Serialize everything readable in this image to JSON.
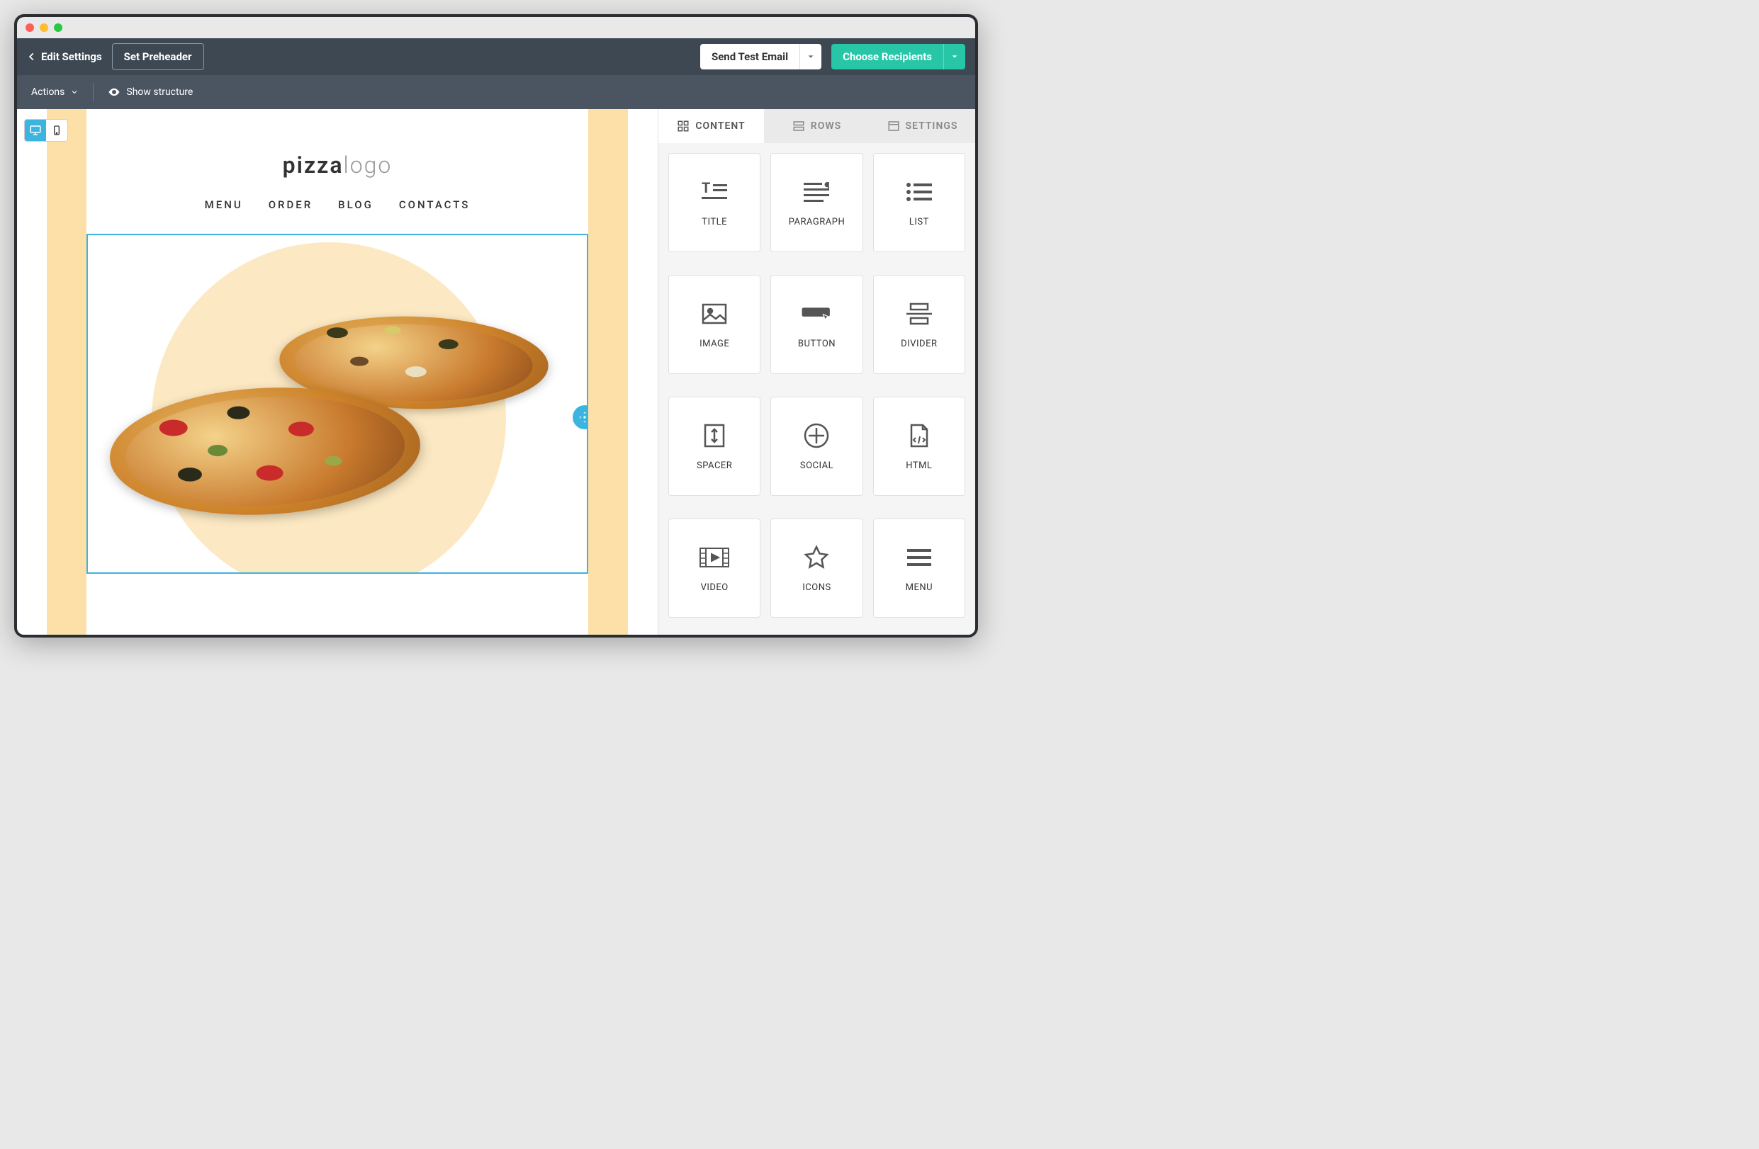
{
  "toolbar": {
    "edit_settings": "Edit Settings",
    "set_preheader": "Set Preheader",
    "send_test": "Send Test Email",
    "choose_recipients": "Choose Recipients"
  },
  "subbar": {
    "actions": "Actions",
    "show_structure": "Show structure"
  },
  "email": {
    "logo_bold": "pizza",
    "logo_light": "logo",
    "nav": [
      "MENU",
      "ORDER",
      "BLOG",
      "CONTACTS"
    ]
  },
  "panel": {
    "tabs": [
      "CONTENT",
      "ROWS",
      "SETTINGS"
    ],
    "blocks": [
      "TITLE",
      "PARAGRAPH",
      "LIST",
      "IMAGE",
      "BUTTON",
      "DIVIDER",
      "SPACER",
      "SOCIAL",
      "HTML",
      "VIDEO",
      "ICONS",
      "MENU"
    ]
  }
}
